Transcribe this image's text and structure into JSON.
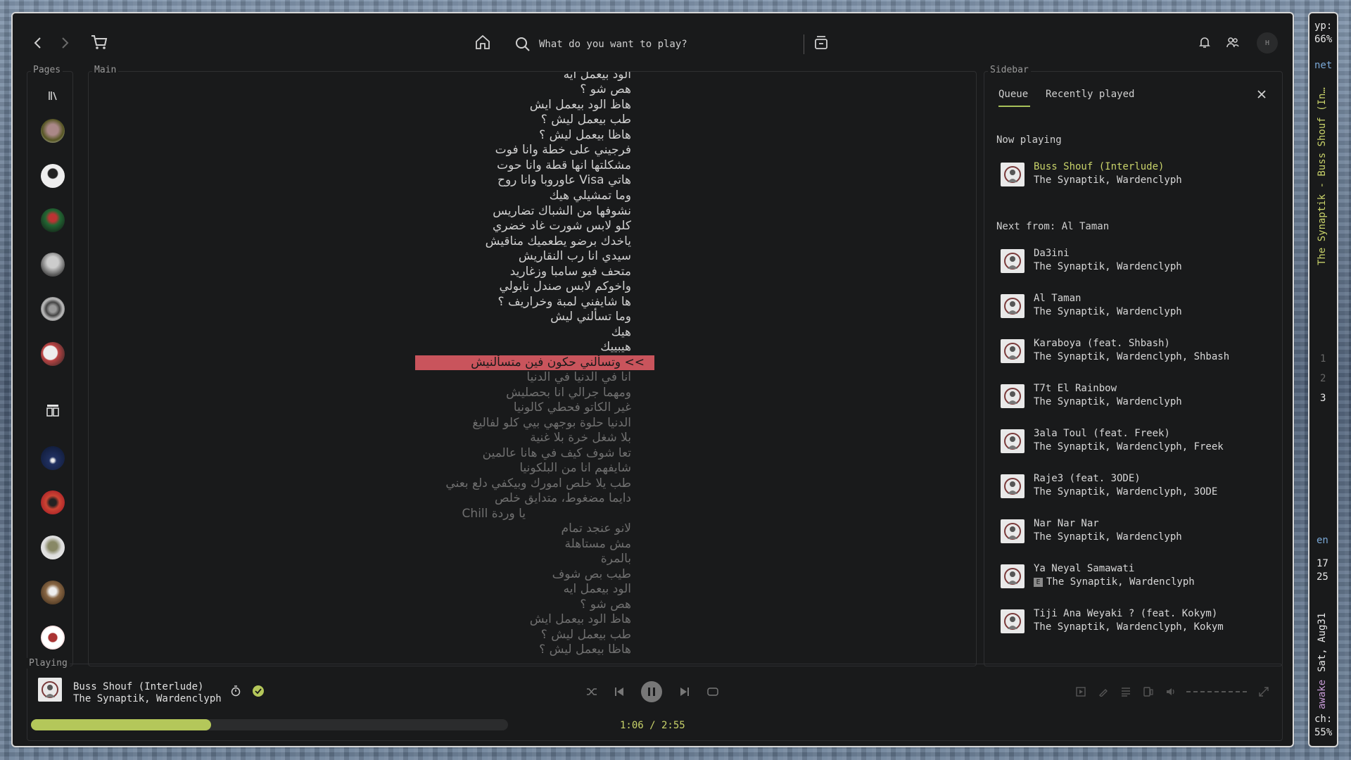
{
  "topbar": {
    "search_placeholder": "What do you want to play?"
  },
  "panels": {
    "pages_label": "Pages",
    "main_label": "Main",
    "sidebar_label": "Sidebar",
    "playing_label": "Playing"
  },
  "lyrics": {
    "past": [
      "الود بيعمل ايه",
      "هص شو ؟",
      "هاظ الود بيعمل ايش",
      "طب بيعمل ليش ؟",
      "هاظا بيعمل ليش ؟",
      "فرجيني على خطة وانا فوت",
      "مشكلتها انها قطة وانا حوت",
      "هاتي Visa عاوروبا وانا روح",
      "وما تمشيلي هيك",
      "نشوفها من الشباك تضاريس",
      "كلو لابس شورت غاد خضري",
      "ياخدك برضو يطعميك مناقيش",
      "سيدي انا رب النقاريش",
      "متحف فيو سامبا وزغاريد",
      "واخوكم لابس صندل نابولي",
      "ها شايفني لمبة وخراريف ؟",
      "وما تسألني ليش",
      "هيك",
      "هيبييك"
    ],
    "current": "وتسألني حكون فين متسألنيش",
    "current_marker": ">>",
    "future": [
      "انا في الدنيا في الدنيا",
      "ومهما جرالي انا بحصليش",
      "غير الكاتو فحطي كالونيا",
      "الدنيا حلوة بوجهي بيي كلو لفاليغ",
      "بلا شغل خرة بلا غنية",
      "تعا شوف كيف في هانا عالمين",
      "شايفهم انا من البلكونيا",
      "طب يلا خلص امورك وبيكفي دلع بعني",
      "دايما مضغوط، متدايق خلص",
      "يا وردة Chill",
      "لانو عنجد تمام",
      "مش مستاهلة",
      "بالمرة",
      "طيب بص شوف",
      "الود بيعمل ايه",
      "هص شو ؟",
      "هاظ الود بيعمل ايش",
      "طب بيعمل ليش ؟",
      "هاظا بيعمل ليش ؟"
    ]
  },
  "sidebar": {
    "tabs": [
      "Queue",
      "Recently played"
    ],
    "now_playing_title": "Now playing",
    "now_playing": {
      "title": "Buss Shouf (Interlude)",
      "artist": "The Synaptik, Wardenclyph"
    },
    "next_from_title": "Next from: Al Taman",
    "queue": [
      {
        "title": "Da3ini",
        "artist": "The Synaptik, Wardenclyph",
        "explicit": false
      },
      {
        "title": "Al Taman",
        "artist": "The Synaptik, Wardenclyph",
        "explicit": false
      },
      {
        "title": "Karaboya (feat. Shbash)",
        "artist": "The Synaptik, Wardenclyph, Shbash",
        "explicit": false
      },
      {
        "title": "T7t El Rainbow",
        "artist": "The Synaptik, Wardenclyph",
        "explicit": false
      },
      {
        "title": "3ala Toul (feat. Freek)",
        "artist": "The Synaptik, Wardenclyph, Freek",
        "explicit": false
      },
      {
        "title": "Raje3 (feat. 3ODE)",
        "artist": "The Synaptik, Wardenclyph, 3ODE",
        "explicit": false
      },
      {
        "title": "Nar Nar Nar",
        "artist": "The Synaptik, Wardenclyph",
        "explicit": false
      },
      {
        "title": "Ya Neyal Samawati",
        "artist": "The Synaptik, Wardenclyph",
        "explicit": true,
        "explicit_badge": "E"
      },
      {
        "title": "Tiji Ana Weyaki ? (feat. Kokym)",
        "artist": "The Synaptik, Wardenclyph, Kokym",
        "explicit": false
      }
    ]
  },
  "player": {
    "title": "Buss Shouf (Interlude)",
    "artist": "The Synaptik, Wardenclyph",
    "time": "1:06 / 2:55",
    "progress": 0.377,
    "accent": "#b4c75a"
  },
  "statusbar": {
    "yp_label": "yp:",
    "yp_value": "66%",
    "net": "net",
    "now_playing_vertical": "The Synaptik - Buss Shouf (In…",
    "workspaces": [
      "1",
      "2",
      "3"
    ],
    "active_workspace": "3",
    "lang": "en",
    "hour": "17",
    "minute": "25",
    "date": "Sat, Aug31",
    "awake": "awake",
    "ch_label": "ch:",
    "ch_value": "55%"
  },
  "colors": {
    "background": "#191a1b",
    "highlight": "#c9545c",
    "active_text": "#c9d36a",
    "awake_text": "#c79bd6",
    "vertical_title": "#c9d36a"
  }
}
